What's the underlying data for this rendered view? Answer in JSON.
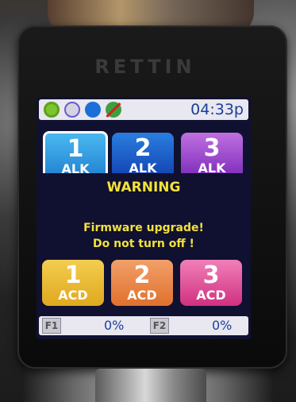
{
  "device": {
    "brand": "RETTIN"
  },
  "status_bar": {
    "icons": [
      "gear-icon",
      "eye-icon",
      "water-drop-icon",
      "no-water-icon"
    ],
    "time": "04:33p"
  },
  "alkaline_buttons": [
    {
      "number": "1",
      "label": "ALK",
      "color": "#2a9ae8"
    },
    {
      "number": "2",
      "label": "ALK",
      "color": "#1a56c8"
    },
    {
      "number": "3",
      "label": "ALK",
      "color": "#9a46cc"
    }
  ],
  "warning": {
    "title": "WARNING",
    "line1": "Firmware upgrade!",
    "line2": "Do not turn off !",
    "color": "#f2e23a"
  },
  "acid_buttons": [
    {
      "number": "1",
      "label": "ACD",
      "color": "#e8b830"
    },
    {
      "number": "2",
      "label": "ACD",
      "color": "#e8884a"
    },
    {
      "number": "3",
      "label": "ACD",
      "color": "#e0509a"
    }
  ],
  "filters": [
    {
      "label": "F1",
      "value": "0%"
    },
    {
      "label": "F2",
      "value": "0%"
    }
  ]
}
